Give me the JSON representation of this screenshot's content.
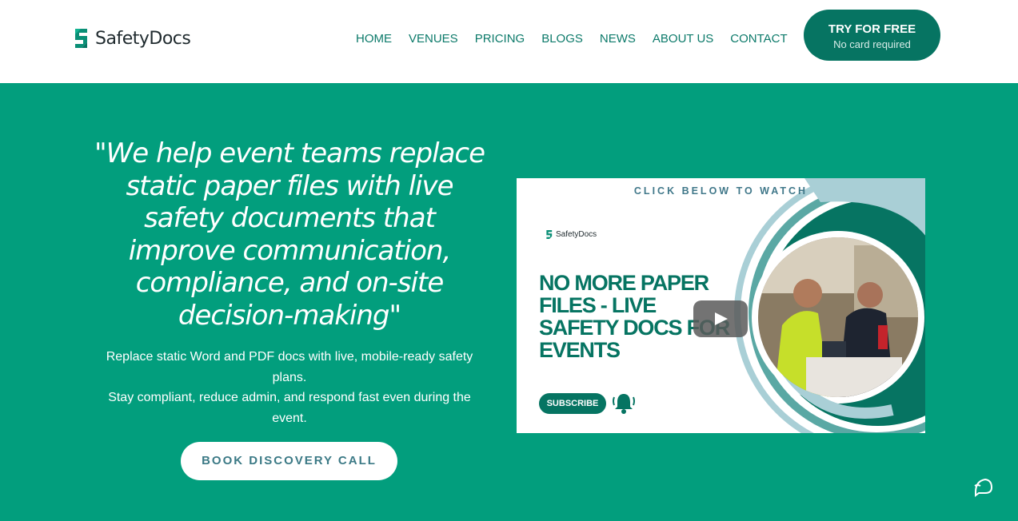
{
  "header": {
    "logo_text": "SafetyDocs",
    "nav": [
      "HOME",
      "VENUES",
      "PRICING",
      "BLOGS",
      "NEWS",
      "ABOUT US",
      "CONTACT"
    ],
    "try_button": {
      "label": "TRY FOR FREE",
      "sublabel": "No card required"
    }
  },
  "hero": {
    "quote": "\"We help event teams replace static paper files with live safety documents that improve communication, compliance, and on-site decision-making\"",
    "description_line1": "Replace static Word and PDF docs with live, mobile-ready safety plans.",
    "description_line2": "Stay compliant, reduce admin, and respond fast even during the event.",
    "book_button": "BOOK DISCOVERY CALL"
  },
  "video": {
    "top_label": "CLICK BELOW TO WATCH",
    "logo_text": "SafetyDocs",
    "headline": "NO MORE PAPER FILES - LIVE SAFETY DOCS FOR EVENTS",
    "subscribe_label": "SUBSCRIBE"
  },
  "colors": {
    "brand": "#067462",
    "hero_bg": "#029e7d",
    "nav_text": "#0c7a6a",
    "button_text": "#3c7a86"
  },
  "icons": [
    "logo-mark-icon",
    "play-icon",
    "bell-icon",
    "chat-icon"
  ]
}
